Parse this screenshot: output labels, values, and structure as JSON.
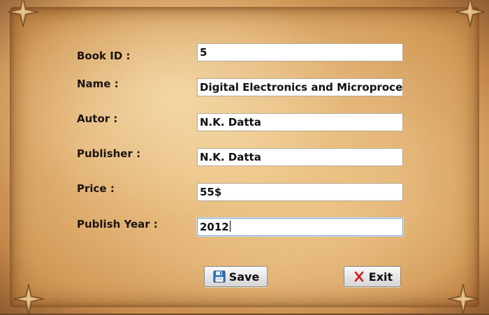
{
  "form": {
    "fields": [
      {
        "label": "Book ID :",
        "value": "5"
      },
      {
        "label": "Name :",
        "value": "Digital Electronics and Microprocess"
      },
      {
        "label": "Autor :",
        "value": "N.K. Datta"
      },
      {
        "label": "Publisher :",
        "value": "N.K. Datta"
      },
      {
        "label": "Price :",
        "value": "55$"
      },
      {
        "label": "Publish Year :",
        "value": "2012"
      }
    ]
  },
  "buttons": {
    "save_label": "Save",
    "exit_label": "Exit"
  },
  "icons": {
    "save": "floppy-disk-icon",
    "exit": "red-x-icon",
    "corners": "star-ornament-icon"
  },
  "colors": {
    "parchment": "#e1b173",
    "frame": "#8e5c31",
    "exit_icon": "#d11a1a",
    "save_icon": "#2f6db5"
  }
}
